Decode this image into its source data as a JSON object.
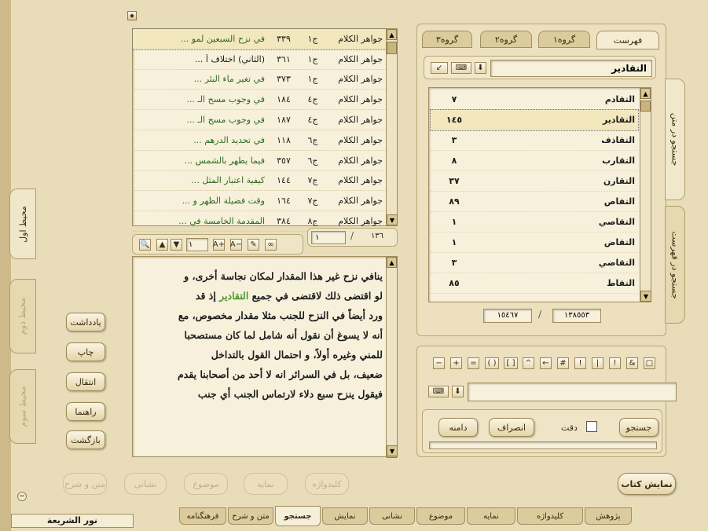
{
  "results": {
    "rows": [
      {
        "book": "جواهر الكلام",
        "vol": "ج١",
        "page": "٣٣٩",
        "title": "في نزح السبعين لمو ..."
      },
      {
        "book": "جواهر الكلام",
        "vol": "ج١",
        "page": "٣٦١",
        "title": "(الثاني) اختلاف أ ..."
      },
      {
        "book": "جواهر الكلام",
        "vol": "ج١",
        "page": "٣٧٣",
        "title": "في تغير ماء البئر ..."
      },
      {
        "book": "جواهر الكلام",
        "vol": "ج٤",
        "page": "١٨٤",
        "title": "في وجوب مسح الـ ..."
      },
      {
        "book": "جواهر الكلام",
        "vol": "ج٤",
        "page": "١٨٧",
        "title": "في وجوب مسح الـ ..."
      },
      {
        "book": "جواهر الكلام",
        "vol": "ج٦",
        "page": "١١٨",
        "title": "في تحديد الدرهم ..."
      },
      {
        "book": "جواهر الكلام",
        "vol": "ج٦",
        "page": "٣٥٧",
        "title": "فيما يطهر بالشمس ..."
      },
      {
        "book": "جواهر الكلام",
        "vol": "ج٧",
        "page": "١٤٤",
        "title": "كيفية اعتبار المثل ..."
      },
      {
        "book": "جواهر الكلام",
        "vol": "ج٧",
        "page": "١٦٤",
        "title": "وقت فضيلة الظهر و ..."
      },
      {
        "book": "جواهر الكلام",
        "vol": "ج٨",
        "page": "٣٨٤",
        "title": "المقدمة الخامسة في ..."
      }
    ],
    "counter_total": "١٣٦",
    "counter_current": "١",
    "page_input": "١"
  },
  "text": {
    "lines": [
      {
        "before": "ينافي نزح غير هذا المقدار لمكان نجاسة أخرى، و",
        "hl": "",
        "after": ""
      },
      {
        "before": "لو اقتضى ذلك لاقتضى في جميع ",
        "hl": "التقادير",
        "after": " إذ قد"
      },
      {
        "before": "ورد أيضاً في النزح للجنب مثلا مقدار مخصوص، مع",
        "hl": "",
        "after": ""
      },
      {
        "before": "أنه لا يسوغ أن نقول أنه شامل لما كان مستصحبا",
        "hl": "",
        "after": ""
      },
      {
        "before": "للمني وغيره أولاً، و احتمال القول بالتداخل",
        "hl": "",
        "after": ""
      },
      {
        "before": "ضعيف، بل في السرائر انه لا أحد من أصحابنا يقدم",
        "hl": "",
        "after": ""
      },
      {
        "before": "فيقول ينزح سبع دلاء لارتماس الجنب أي جنب",
        "hl": "",
        "after": ""
      }
    ]
  },
  "right_tabs": [
    "فهرست",
    "گروه١",
    "گروه٢",
    "گروه٣"
  ],
  "search_word": "التقادير",
  "words": [
    {
      "word": "التقادم",
      "count": "٧"
    },
    {
      "word": "التقادير",
      "count": "١٤٥"
    },
    {
      "word": "التقاذف",
      "count": "٣"
    },
    {
      "word": "التقارب",
      "count": "٨"
    },
    {
      "word": "التقارن",
      "count": "٣٧"
    },
    {
      "word": "التقاص",
      "count": "٨٩"
    },
    {
      "word": "التقاصي",
      "count": "١"
    },
    {
      "word": "التقاض",
      "count": "١"
    },
    {
      "word": "التقاضي",
      "count": "٣"
    },
    {
      "word": "التقاط",
      "count": "٨٥"
    }
  ],
  "word_counter_total": "١٣٨٥٥٣",
  "word_counter_current": "١٥٤٦٧",
  "symbols": [
    "□",
    "&",
    "!",
    "|",
    "!",
    "#",
    "←",
    "^",
    "[ ]",
    "( )",
    "=",
    "+",
    "−"
  ],
  "search_panel": {
    "search_label": "جستجو",
    "exact_label": "دقت",
    "cancel_label": "انصراف",
    "more_label": "دامنه"
  },
  "right_vtabs": [
    "جستجو در متن",
    "جستجو در فهرست"
  ],
  "left_vtabs": [
    "محيط اول",
    "محيط دوم",
    "محيط سوم"
  ],
  "side_buttons": [
    "يادداشت",
    "چاپ",
    "انتقال",
    "راهنما",
    "بازگشت"
  ],
  "action_buttons": [
    "متن و شرح",
    "نشانی",
    "موضوع",
    "نمايه",
    "كليدواژه"
  ],
  "show_book_label": "نمايش كتاب",
  "bottom_tabs": [
    "پژوهش",
    "كليدواژه",
    "نمايه",
    "موضوع",
    "نشانی",
    "نمايش",
    "جستجو",
    "متن و شرح",
    "فرهنگنامه"
  ],
  "brand": "نور الشريعة"
}
